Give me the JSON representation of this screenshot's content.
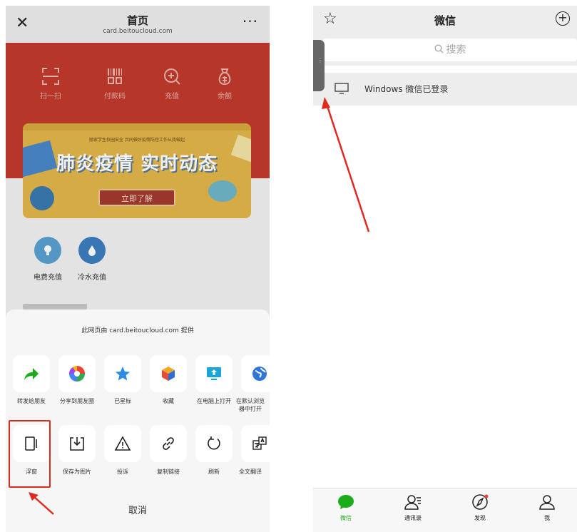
{
  "left_screen": {
    "nav": {
      "close_glyph": "✕",
      "title": "首页",
      "subtitle": "card.beitoucloud.com",
      "more_glyph": "···"
    },
    "quick_actions": [
      {
        "label": "扫一扫",
        "icon": "scan-icon"
      },
      {
        "label": "付款码",
        "icon": "barcode-icon"
      },
      {
        "label": "充值",
        "icon": "recharge-icon"
      },
      {
        "label": "余额",
        "icon": "money-bag-icon"
      }
    ],
    "banner": {
      "topline": "哪家学生校园安全 共同做好疫情防控工作从我做起",
      "headline": "肺炎疫情 实时动态",
      "cta": "立即了解"
    },
    "services": [
      {
        "label": "电费充值",
        "icon": "bulb-icon"
      },
      {
        "label": "冷水充值",
        "icon": "water-drop-icon"
      }
    ],
    "share_sheet": {
      "provider": "此网页由 card.beitoucloud.com 提供",
      "row1": [
        {
          "label": "转发给朋友",
          "icon": "forward-icon"
        },
        {
          "label": "分享到朋友圈",
          "icon": "moments-icon"
        },
        {
          "label": "已星标",
          "icon": "star-icon"
        },
        {
          "label": "收藏",
          "icon": "favorite-cube-icon"
        },
        {
          "label": "在电脑上打开",
          "icon": "open-on-pc-icon"
        },
        {
          "label": "在默认浏览器中打开",
          "icon": "browser-icon"
        }
      ],
      "row2": [
        {
          "label": "浮窗",
          "icon": "float-window-icon"
        },
        {
          "label": "保存为图片",
          "icon": "save-image-icon"
        },
        {
          "label": "投诉",
          "icon": "warning-icon"
        },
        {
          "label": "复制链接",
          "icon": "link-icon"
        },
        {
          "label": "刷新",
          "icon": "refresh-icon"
        },
        {
          "label": "全文翻译",
          "icon": "translate-icon"
        }
      ],
      "cancel": "取消"
    }
  },
  "right_screen": {
    "nav": {
      "title": "微信",
      "star_glyph": "☆",
      "plus_glyph": "+"
    },
    "search": {
      "placeholder": "搜索"
    },
    "pc_status": "Windows 微信已登录",
    "handle_glyph": "⋮",
    "tabs": [
      {
        "label": "微信",
        "icon": "chat-icon",
        "active": true
      },
      {
        "label": "通讯录",
        "icon": "contacts-icon",
        "active": false
      },
      {
        "label": "发现",
        "icon": "compass-icon",
        "active": false
      },
      {
        "label": "我",
        "icon": "person-icon",
        "active": false
      }
    ]
  },
  "colors": {
    "wechat_green": "#1aad19",
    "highlight_red": "#e02a20",
    "header_red": "#c23a2c"
  }
}
